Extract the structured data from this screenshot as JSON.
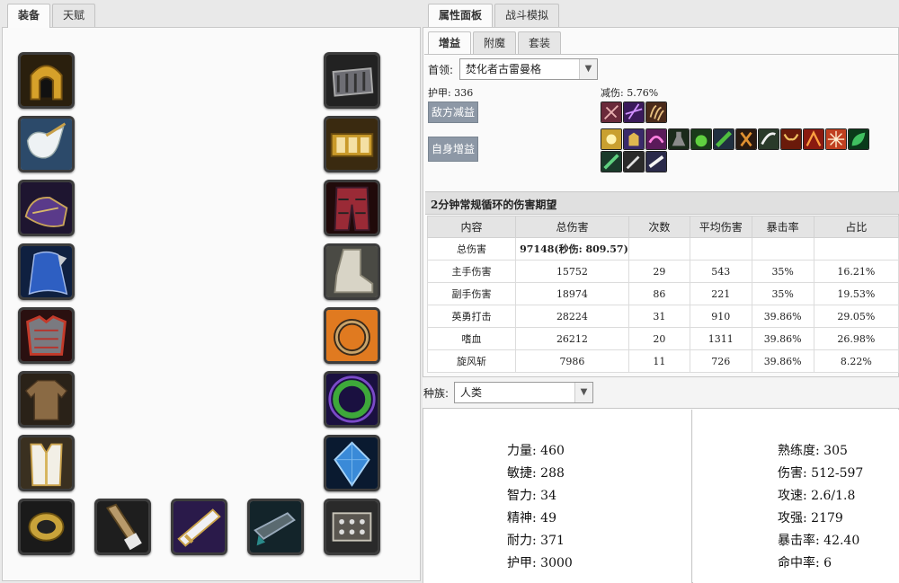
{
  "left_tabs": [
    "装备",
    "天赋"
  ],
  "right_tabs": [
    "属性面板",
    "战斗模拟"
  ],
  "sub_tabs": [
    "增益",
    "附魔",
    "套装"
  ],
  "boss_label": "首领:",
  "boss_value": "焚化者古雷曼格",
  "armor_text": "护甲: 336",
  "reduction_text": "减伤: 5.76%",
  "enemy_debuff_btn": "敌方减益",
  "self_buff_btn": "自身增益",
  "dps_section_title": "2分钟常规循环的伤害期望",
  "table_headers": [
    "内容",
    "总伤害",
    "次数",
    "平均伤害",
    "暴击率",
    "占比"
  ],
  "table_rows": [
    [
      "总伤害",
      "97148(秒伤: 809.57)",
      "",
      "",
      "",
      ""
    ],
    [
      "主手伤害",
      "15752",
      "29",
      "543",
      "35%",
      "16.21%"
    ],
    [
      "副手伤害",
      "18974",
      "86",
      "221",
      "35%",
      "19.53%"
    ],
    [
      "英勇打击",
      "28224",
      "31",
      "910",
      "39.86%",
      "29.05%"
    ],
    [
      "嗜血",
      "26212",
      "20",
      "1311",
      "39.86%",
      "26.98%"
    ],
    [
      "旋风斩",
      "7986",
      "11",
      "726",
      "39.86%",
      "8.22%"
    ]
  ],
  "race_label": "种族:",
  "race_value": "人类",
  "stats_left": [
    "力量: 460",
    "敏捷: 288",
    "智力: 34",
    "精神: 49",
    "耐力: 371",
    "护甲: 3000"
  ],
  "stats_right": [
    "熟练度: 305",
    "伤害: 512-597",
    "攻速: 2.6/1.8",
    "攻强: 2179",
    "暴击率: 42.40",
    "命中率: 6"
  ],
  "equip_left_icons": [
    "helm-icon",
    "neck-icon",
    "shoulder-icon",
    "cloak-icon",
    "chest-icon",
    "shirt-icon",
    "tabard-icon",
    "bracer-icon"
  ],
  "equip_right_icons": [
    "gloves-icon",
    "belt-icon",
    "legs-icon",
    "boots-icon",
    "ring-icon",
    "ring2-icon",
    "trinket-icon",
    "trinket2-icon"
  ],
  "equip_bottom_icons": [
    "mainhand-icon",
    "offhand-icon",
    "ranged-icon",
    "relic-icon"
  ],
  "enemy_debuff_icons": [
    "sunder-icon",
    "shadow-icon",
    "claw-icon"
  ],
  "self_buff_icons": [
    "blessing-icon",
    "kings-icon",
    "motw-icon",
    "flask-icon",
    "potion-icon",
    "food-icon",
    "stance-icon",
    "horn-icon",
    "bull-icon",
    "rage-icon",
    "bloodlust-icon",
    "leaf-icon",
    "tree-icon",
    "sword-icon",
    "scroll-icon"
  ],
  "colors": {
    "accent_gray": "#8d98a6"
  }
}
